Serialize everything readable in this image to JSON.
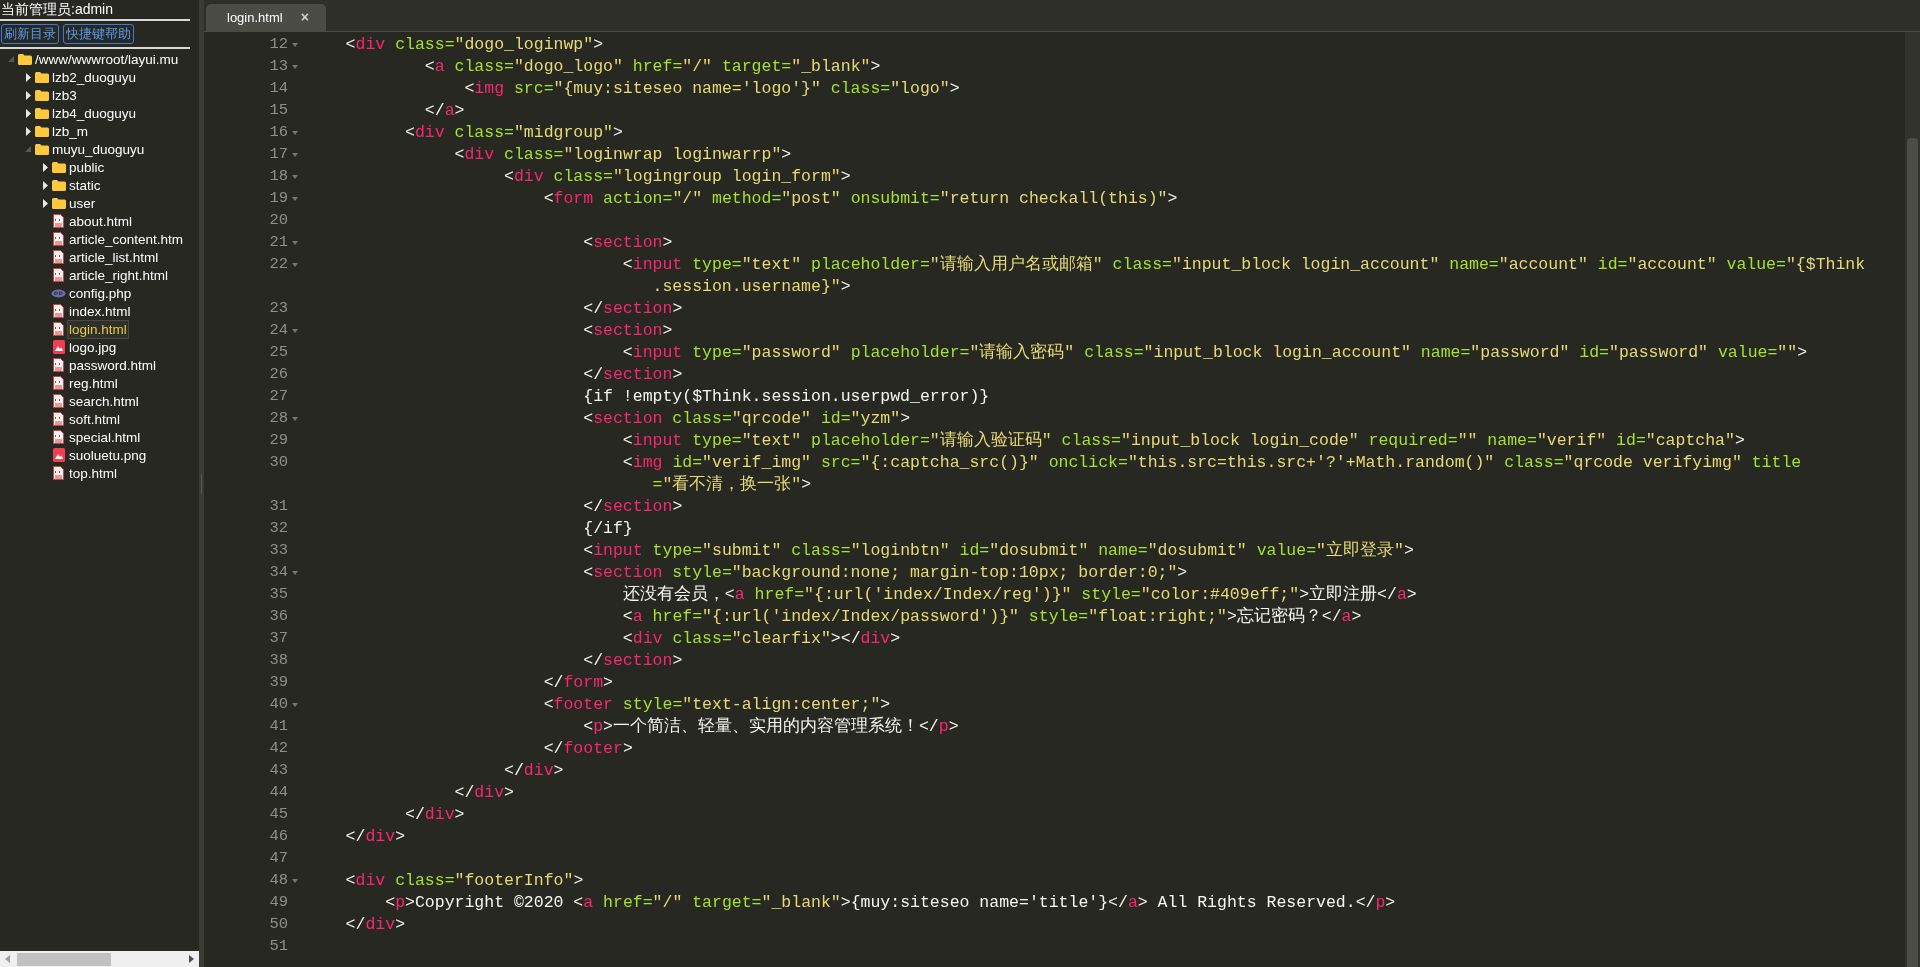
{
  "sidebar": {
    "admin_label": "当前管理员:admin",
    "buttons": [
      "刷新目录",
      "快捷键帮助"
    ],
    "tree": [
      {
        "label": "/www/wwwroot/layui.mu",
        "kind": "folder",
        "expanded": true,
        "selected": false,
        "children": [
          {
            "label": "lzb2_duoguyu",
            "kind": "folder",
            "expanded": false,
            "selected": false
          },
          {
            "label": "lzb3",
            "kind": "folder",
            "expanded": false,
            "selected": false
          },
          {
            "label": "lzb4_duoguyu",
            "kind": "folder",
            "expanded": false,
            "selected": false
          },
          {
            "label": "lzb_m",
            "kind": "folder",
            "expanded": false,
            "selected": false
          },
          {
            "label": "muyu_duoguyu",
            "kind": "folder",
            "expanded": true,
            "selected": false,
            "children": [
              {
                "label": "public",
                "kind": "folder",
                "expanded": false,
                "selected": false
              },
              {
                "label": "static",
                "kind": "folder",
                "expanded": false,
                "selected": false
              },
              {
                "label": "user",
                "kind": "folder",
                "expanded": false,
                "selected": false
              },
              {
                "label": "about.html",
                "kind": "html",
                "selected": false
              },
              {
                "label": "article_content.htm",
                "kind": "html",
                "selected": false
              },
              {
                "label": "article_list.html",
                "kind": "html",
                "selected": false
              },
              {
                "label": "article_right.html",
                "kind": "html",
                "selected": false
              },
              {
                "label": "config.php",
                "kind": "php",
                "selected": false
              },
              {
                "label": "index.html",
                "kind": "html",
                "selected": false
              },
              {
                "label": "login.html",
                "kind": "html",
                "selected": true
              },
              {
                "label": "logo.jpg",
                "kind": "image",
                "selected": false
              },
              {
                "label": "password.html",
                "kind": "html",
                "selected": false
              },
              {
                "label": "reg.html",
                "kind": "html",
                "selected": false
              },
              {
                "label": "search.html",
                "kind": "html",
                "selected": false
              },
              {
                "label": "soft.html",
                "kind": "html",
                "selected": false
              },
              {
                "label": "special.html",
                "kind": "html",
                "selected": false
              },
              {
                "label": "suoluetu.png",
                "kind": "image",
                "selected": false
              },
              {
                "label": "top.html",
                "kind": "html",
                "selected": false
              }
            ]
          }
        ]
      }
    ]
  },
  "tabs": [
    {
      "label": "login.html",
      "close": "×",
      "selected": true
    }
  ],
  "editor": {
    "lines": [
      {
        "n": "12",
        "fold": true,
        "code": [
          {
            "kind": "plain",
            "text": "    <"
          },
          {
            "kind": "tag",
            "text": "div"
          },
          {
            "kind": "attr",
            "text": " class="
          },
          {
            "kind": "string",
            "text": "\"dogo_loginwp\""
          },
          {
            "kind": "plain",
            "text": ">"
          }
        ]
      },
      {
        "n": "13",
        "fold": true,
        "code": [
          {
            "kind": "plain",
            "text": "            <"
          },
          {
            "kind": "tag",
            "text": "a"
          },
          {
            "kind": "attr",
            "text": " class="
          },
          {
            "kind": "string",
            "text": "\"dogo_logo\""
          },
          {
            "kind": "attr",
            "text": " href="
          },
          {
            "kind": "string",
            "text": "\"/\""
          },
          {
            "kind": "attr",
            "text": " target="
          },
          {
            "kind": "string",
            "text": "\"_blank\""
          },
          {
            "kind": "plain",
            "text": ">"
          }
        ]
      },
      {
        "n": "14",
        "fold": false,
        "code": [
          {
            "kind": "plain",
            "text": "                <"
          },
          {
            "kind": "tag",
            "text": "img"
          },
          {
            "kind": "attr",
            "text": " src="
          },
          {
            "kind": "string",
            "text": "\"{muy:siteseo name='logo'}\""
          },
          {
            "kind": "attr",
            "text": " class="
          },
          {
            "kind": "string",
            "text": "\"logo\""
          },
          {
            "kind": "plain",
            "text": ">"
          }
        ]
      },
      {
        "n": "15",
        "fold": false,
        "code": [
          {
            "kind": "plain",
            "text": "            </"
          },
          {
            "kind": "tag",
            "text": "a"
          },
          {
            "kind": "plain",
            "text": ">"
          }
        ]
      },
      {
        "n": "16",
        "fold": true,
        "code": [
          {
            "kind": "plain",
            "text": "          <"
          },
          {
            "kind": "tag",
            "text": "div"
          },
          {
            "kind": "attr",
            "text": " class="
          },
          {
            "kind": "string",
            "text": "\"midgroup\""
          },
          {
            "kind": "plain",
            "text": ">"
          }
        ]
      },
      {
        "n": "17",
        "fold": true,
        "code": [
          {
            "kind": "plain",
            "text": "               <"
          },
          {
            "kind": "tag",
            "text": "div"
          },
          {
            "kind": "attr",
            "text": " class="
          },
          {
            "kind": "string",
            "text": "\"loginwrap loginwarrp\""
          },
          {
            "kind": "plain",
            "text": ">"
          }
        ]
      },
      {
        "n": "18",
        "fold": true,
        "code": [
          {
            "kind": "plain",
            "text": "                    <"
          },
          {
            "kind": "tag",
            "text": "div"
          },
          {
            "kind": "attr",
            "text": " class="
          },
          {
            "kind": "string",
            "text": "\"logingroup login_form\""
          },
          {
            "kind": "plain",
            "text": ">"
          }
        ]
      },
      {
        "n": "19",
        "fold": true,
        "code": [
          {
            "kind": "plain",
            "text": "                        <"
          },
          {
            "kind": "tag",
            "text": "form"
          },
          {
            "kind": "attr",
            "text": " action="
          },
          {
            "kind": "string",
            "text": "\"/\""
          },
          {
            "kind": "attr",
            "text": " method="
          },
          {
            "kind": "string",
            "text": "\"post\""
          },
          {
            "kind": "attr",
            "text": " onsubmit="
          },
          {
            "kind": "string",
            "text": "\"return checkall(this)\""
          },
          {
            "kind": "plain",
            "text": ">"
          }
        ]
      },
      {
        "n": "20",
        "fold": false
      },
      {
        "n": "21",
        "fold": true,
        "code": [
          {
            "kind": "plain",
            "text": "                            <"
          },
          {
            "kind": "tag",
            "text": "section"
          },
          {
            "kind": "plain",
            "text": ">"
          }
        ]
      },
      {
        "n": "22",
        "fold": true,
        "code": [
          {
            "kind": "plain",
            "text": "                                <"
          },
          {
            "kind": "tag",
            "text": "input"
          },
          {
            "kind": "attr",
            "text": " type="
          },
          {
            "kind": "string",
            "text": "\"text\""
          },
          {
            "kind": "attr",
            "text": " placeholder="
          },
          {
            "kind": "string",
            "text": "\"请输入用户名或邮箱\""
          },
          {
            "kind": "attr",
            "text": " class="
          },
          {
            "kind": "string",
            "text": "\"input_block login_account\""
          },
          {
            "kind": "attr",
            "text": " name="
          },
          {
            "kind": "string",
            "text": "\"account\""
          },
          {
            "kind": "attr",
            "text": " id="
          },
          {
            "kind": "string",
            "text": "\"account\""
          },
          {
            "kind": "attr",
            "text": " value="
          },
          {
            "kind": "string",
            "text": "\"{$Think"
          }
        ],
        "wrap": [
          {
            "kind": "string",
            "text": "                                   .session.username}\""
          },
          {
            "kind": "plain",
            "text": ">"
          }
        ]
      },
      {
        "n": "23",
        "fold": false,
        "code": [
          {
            "kind": "plain",
            "text": "                            </"
          },
          {
            "kind": "tag",
            "text": "section"
          },
          {
            "kind": "plain",
            "text": ">"
          }
        ]
      },
      {
        "n": "24",
        "fold": true,
        "code": [
          {
            "kind": "plain",
            "text": "                            <"
          },
          {
            "kind": "tag",
            "text": "section"
          },
          {
            "kind": "plain",
            "text": ">"
          }
        ]
      },
      {
        "n": "25",
        "fold": false,
        "code": [
          {
            "kind": "plain",
            "text": "                                <"
          },
          {
            "kind": "tag",
            "text": "input"
          },
          {
            "kind": "attr",
            "text": " type="
          },
          {
            "kind": "string",
            "text": "\"password\""
          },
          {
            "kind": "attr",
            "text": " placeholder="
          },
          {
            "kind": "string",
            "text": "\"请输入密码\""
          },
          {
            "kind": "attr",
            "text": " class="
          },
          {
            "kind": "string",
            "text": "\"input_block login_account\""
          },
          {
            "kind": "attr",
            "text": " name="
          },
          {
            "kind": "string",
            "text": "\"password\""
          },
          {
            "kind": "attr",
            "text": " id="
          },
          {
            "kind": "string",
            "text": "\"password\""
          },
          {
            "kind": "attr",
            "text": " value="
          },
          {
            "kind": "string",
            "text": "\"\""
          },
          {
            "kind": "plain",
            "text": ">"
          }
        ]
      },
      {
        "n": "26",
        "fold": false,
        "code": [
          {
            "kind": "plain",
            "text": "                            </"
          },
          {
            "kind": "tag",
            "text": "section"
          },
          {
            "kind": "plain",
            "text": ">"
          }
        ]
      },
      {
        "n": "27",
        "fold": false,
        "code": [
          {
            "kind": "plain",
            "text": "                            {if !empty($Think.session.userpwd_error)}"
          }
        ]
      },
      {
        "n": "28",
        "fold": true,
        "code": [
          {
            "kind": "plain",
            "text": "                            <"
          },
          {
            "kind": "tag",
            "text": "section"
          },
          {
            "kind": "attr",
            "text": " class="
          },
          {
            "kind": "string",
            "text": "\"qrcode\""
          },
          {
            "kind": "attr",
            "text": " id="
          },
          {
            "kind": "string",
            "text": "\"yzm\""
          },
          {
            "kind": "plain",
            "text": ">"
          }
        ]
      },
      {
        "n": "29",
        "fold": false,
        "code": [
          {
            "kind": "plain",
            "text": "                                <"
          },
          {
            "kind": "tag",
            "text": "input"
          },
          {
            "kind": "attr",
            "text": " type="
          },
          {
            "kind": "string",
            "text": "\"text\""
          },
          {
            "kind": "attr",
            "text": " placeholder="
          },
          {
            "kind": "string",
            "text": "\"请输入验证码\""
          },
          {
            "kind": "attr",
            "text": " class="
          },
          {
            "kind": "string",
            "text": "\"input_block login_code\""
          },
          {
            "kind": "attr",
            "text": " required="
          },
          {
            "kind": "string",
            "text": "\"\""
          },
          {
            "kind": "attr",
            "text": " name="
          },
          {
            "kind": "string",
            "text": "\"verif\""
          },
          {
            "kind": "attr",
            "text": " id="
          },
          {
            "kind": "string",
            "text": "\"captcha\""
          },
          {
            "kind": "plain",
            "text": ">"
          }
        ]
      },
      {
        "n": "30",
        "fold": false,
        "code": [
          {
            "kind": "plain",
            "text": "                                <"
          },
          {
            "kind": "tag",
            "text": "img"
          },
          {
            "kind": "attr",
            "text": " id="
          },
          {
            "kind": "string",
            "text": "\"verif_img\""
          },
          {
            "kind": "attr",
            "text": " src="
          },
          {
            "kind": "string",
            "text": "\"{:captcha_src()}\""
          },
          {
            "kind": "attr",
            "text": " onclick="
          },
          {
            "kind": "string",
            "text": "\"this.src=this.src+'?'+Math.random()\""
          },
          {
            "kind": "attr",
            "text": " class="
          },
          {
            "kind": "string",
            "text": "\"qrcode verifyimg\""
          },
          {
            "kind": "attr",
            "text": " title"
          }
        ],
        "wrap": [
          {
            "kind": "attr",
            "text": "                                   ="
          },
          {
            "kind": "string",
            "text": "\"看不清，换一张\""
          },
          {
            "kind": "plain",
            "text": ">"
          }
        ]
      },
      {
        "n": "31",
        "fold": false,
        "code": [
          {
            "kind": "plain",
            "text": "                            </"
          },
          {
            "kind": "tag",
            "text": "section"
          },
          {
            "kind": "plain",
            "text": ">"
          }
        ]
      },
      {
        "n": "32",
        "fold": false,
        "code": [
          {
            "kind": "plain",
            "text": "                            {/if}"
          }
        ]
      },
      {
        "n": "33",
        "fold": false,
        "code": [
          {
            "kind": "plain",
            "text": "                            <"
          },
          {
            "kind": "tag",
            "text": "input"
          },
          {
            "kind": "attr",
            "text": " type="
          },
          {
            "kind": "string",
            "text": "\"submit\""
          },
          {
            "kind": "attr",
            "text": " class="
          },
          {
            "kind": "string",
            "text": "\"loginbtn\""
          },
          {
            "kind": "attr",
            "text": " id="
          },
          {
            "kind": "string",
            "text": "\"dosubmit\""
          },
          {
            "kind": "attr",
            "text": " name="
          },
          {
            "kind": "string",
            "text": "\"dosubmit\""
          },
          {
            "kind": "attr",
            "text": " value="
          },
          {
            "kind": "string",
            "text": "\"立即登录\""
          },
          {
            "kind": "plain",
            "text": ">"
          }
        ]
      },
      {
        "n": "34",
        "fold": true,
        "code": [
          {
            "kind": "plain",
            "text": "                            <"
          },
          {
            "kind": "tag",
            "text": "section"
          },
          {
            "kind": "attr",
            "text": " style="
          },
          {
            "kind": "string",
            "text": "\"background:none; margin-top:10px; border:0;\""
          },
          {
            "kind": "plain",
            "text": ">"
          }
        ]
      },
      {
        "n": "35",
        "fold": false,
        "code": [
          {
            "kind": "plain",
            "text": "                                还没有会员，<"
          },
          {
            "kind": "tag",
            "text": "a"
          },
          {
            "kind": "attr",
            "text": " href="
          },
          {
            "kind": "string",
            "text": "\"{:url('index/Index/reg')}\""
          },
          {
            "kind": "attr",
            "text": " style="
          },
          {
            "kind": "string",
            "text": "\"color:#409eff;\""
          },
          {
            "kind": "plain",
            "text": ">立即注册</"
          },
          {
            "kind": "tag",
            "text": "a"
          },
          {
            "kind": "plain",
            "text": ">"
          }
        ]
      },
      {
        "n": "36",
        "fold": false,
        "code": [
          {
            "kind": "plain",
            "text": "                                <"
          },
          {
            "kind": "tag",
            "text": "a"
          },
          {
            "kind": "attr",
            "text": " href="
          },
          {
            "kind": "string",
            "text": "\"{:url('index/Index/password')}\""
          },
          {
            "kind": "attr",
            "text": " style="
          },
          {
            "kind": "string",
            "text": "\"float:right;\""
          },
          {
            "kind": "plain",
            "text": ">忘记密码？</"
          },
          {
            "kind": "tag",
            "text": "a"
          },
          {
            "kind": "plain",
            "text": ">"
          }
        ]
      },
      {
        "n": "37",
        "fold": false,
        "code": [
          {
            "kind": "plain",
            "text": "                                <"
          },
          {
            "kind": "tag",
            "text": "div"
          },
          {
            "kind": "attr",
            "text": " class="
          },
          {
            "kind": "string",
            "text": "\"clearfix\""
          },
          {
            "kind": "plain",
            "text": "></"
          },
          {
            "kind": "tag",
            "text": "div"
          },
          {
            "kind": "plain",
            "text": ">"
          }
        ]
      },
      {
        "n": "38",
        "fold": false,
        "code": [
          {
            "kind": "plain",
            "text": "                            </"
          },
          {
            "kind": "tag",
            "text": "section"
          },
          {
            "kind": "plain",
            "text": ">"
          }
        ]
      },
      {
        "n": "39",
        "fold": false,
        "code": [
          {
            "kind": "plain",
            "text": "                        </"
          },
          {
            "kind": "tag",
            "text": "form"
          },
          {
            "kind": "plain",
            "text": ">"
          }
        ]
      },
      {
        "n": "40",
        "fold": true,
        "code": [
          {
            "kind": "plain",
            "text": "                        <"
          },
          {
            "kind": "tag",
            "text": "footer"
          },
          {
            "kind": "attr",
            "text": " style="
          },
          {
            "kind": "string",
            "text": "\"text-align:center;\""
          },
          {
            "kind": "plain",
            "text": ">"
          }
        ]
      },
      {
        "n": "41",
        "fold": false,
        "code": [
          {
            "kind": "plain",
            "text": "                            <"
          },
          {
            "kind": "tag",
            "text": "p"
          },
          {
            "kind": "plain",
            "text": ">一个简洁、轻量、实用的内容管理系统！</"
          },
          {
            "kind": "tag",
            "text": "p"
          },
          {
            "kind": "plain",
            "text": ">"
          }
        ]
      },
      {
        "n": "42",
        "fold": false,
        "code": [
          {
            "kind": "plain",
            "text": "                        </"
          },
          {
            "kind": "tag",
            "text": "footer"
          },
          {
            "kind": "plain",
            "text": ">"
          }
        ]
      },
      {
        "n": "43",
        "fold": false,
        "code": [
          {
            "kind": "plain",
            "text": "                    </"
          },
          {
            "kind": "tag",
            "text": "div"
          },
          {
            "kind": "plain",
            "text": ">"
          }
        ]
      },
      {
        "n": "44",
        "fold": false,
        "code": [
          {
            "kind": "plain",
            "text": "               </"
          },
          {
            "kind": "tag",
            "text": "div"
          },
          {
            "kind": "plain",
            "text": ">"
          }
        ]
      },
      {
        "n": "45",
        "fold": false,
        "code": [
          {
            "kind": "plain",
            "text": "          </"
          },
          {
            "kind": "tag",
            "text": "div"
          },
          {
            "kind": "plain",
            "text": ">"
          }
        ]
      },
      {
        "n": "46",
        "fold": false,
        "code": [
          {
            "kind": "plain",
            "text": "    </"
          },
          {
            "kind": "tag",
            "text": "div"
          },
          {
            "kind": "plain",
            "text": ">"
          }
        ]
      },
      {
        "n": "47",
        "fold": false
      },
      {
        "n": "48",
        "fold": true,
        "code": [
          {
            "kind": "plain",
            "text": "    <"
          },
          {
            "kind": "tag",
            "text": "div"
          },
          {
            "kind": "attr",
            "text": " class="
          },
          {
            "kind": "string",
            "text": "\"footerInfo\""
          },
          {
            "kind": "plain",
            "text": ">"
          }
        ]
      },
      {
        "n": "49",
        "fold": false,
        "code": [
          {
            "kind": "plain",
            "text": "        <"
          },
          {
            "kind": "tag",
            "text": "p"
          },
          {
            "kind": "plain",
            "text": ">Copyright ©2020 <"
          },
          {
            "kind": "tag",
            "text": "a"
          },
          {
            "kind": "attr",
            "text": " href="
          },
          {
            "kind": "string",
            "text": "\"/\""
          },
          {
            "kind": "attr",
            "text": " target="
          },
          {
            "kind": "string",
            "text": "\"_blank\""
          },
          {
            "kind": "plain",
            "text": ">{muy:siteseo name='title'}</"
          },
          {
            "kind": "tag",
            "text": "a"
          },
          {
            "kind": "plain",
            "text": "> All Rights Reserved.</"
          },
          {
            "kind": "tag",
            "text": "p"
          },
          {
            "kind": "plain",
            "text": ">"
          }
        ]
      },
      {
        "n": "50",
        "fold": false,
        "code": [
          {
            "kind": "plain",
            "text": "    </"
          },
          {
            "kind": "tag",
            "text": "div"
          },
          {
            "kind": "plain",
            "text": ">"
          }
        ]
      },
      {
        "n": "51",
        "fold": false
      }
    ]
  }
}
